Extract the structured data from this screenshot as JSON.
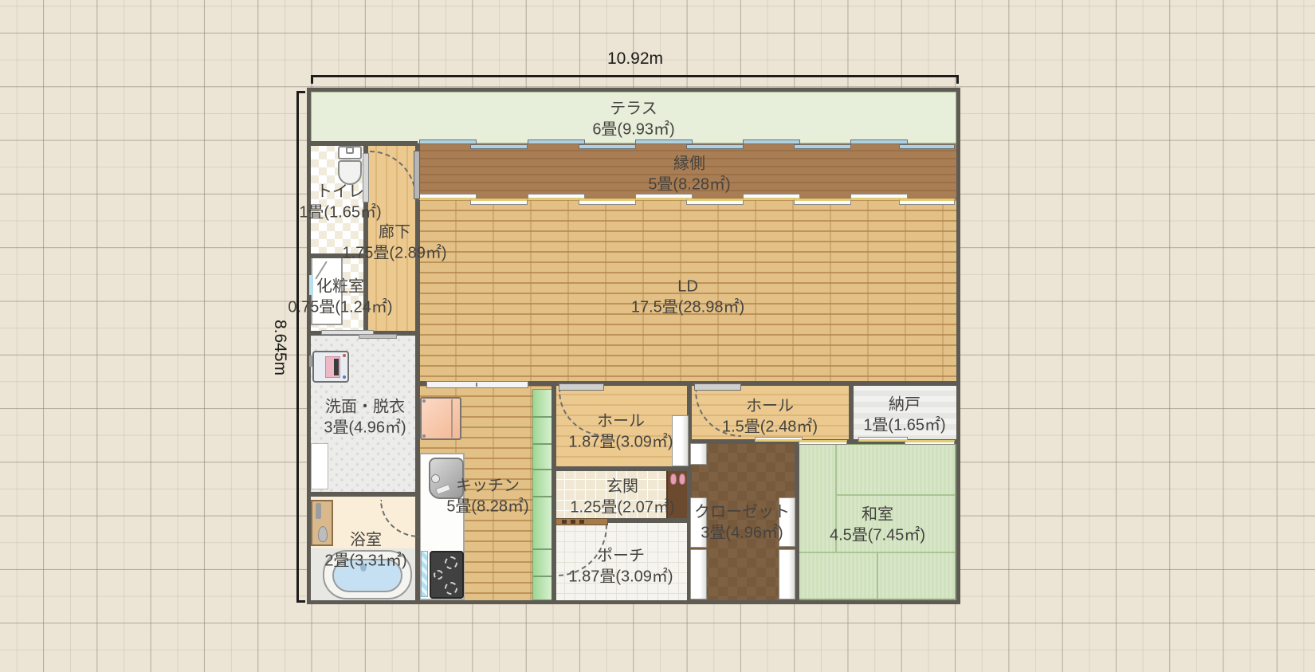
{
  "plan_title": "floor-plan",
  "dimensions": {
    "width_label": "10.92m",
    "height_label": "8.645m"
  },
  "rooms": [
    {
      "id": "terrace",
      "name": "テラス",
      "area": "6畳(9.93㎡)"
    },
    {
      "id": "engawa",
      "name": "縁側",
      "area": "5畳(8.28㎡)"
    },
    {
      "id": "ld",
      "name": "LD",
      "area": "17.5畳(28.98㎡)"
    },
    {
      "id": "toilet",
      "name": "トイレ",
      "area": "1畳(1.65㎡)"
    },
    {
      "id": "corridor",
      "name": "廊下",
      "area": "1.75畳(2.89㎡)"
    },
    {
      "id": "powder",
      "name": "化粧室",
      "area": "0.75畳(1.24㎡)"
    },
    {
      "id": "washroom",
      "name": "洗面・脱衣",
      "area": "3畳(4.96㎡)"
    },
    {
      "id": "bathroom",
      "name": "浴室",
      "area": "2畳(3.31㎡)"
    },
    {
      "id": "kitchen",
      "name": "キッチン",
      "area": "5畳(8.28㎡)"
    },
    {
      "id": "hall1",
      "name": "ホール",
      "area": "1.87畳(3.09㎡)"
    },
    {
      "id": "genkan",
      "name": "玄関",
      "area": "1.25畳(2.07㎡)"
    },
    {
      "id": "porch",
      "name": "ポーチ",
      "area": "1.87畳(3.09㎡)"
    },
    {
      "id": "hall2",
      "name": "ホール",
      "area": "1.5畳(2.48㎡)"
    },
    {
      "id": "nando",
      "name": "納戸",
      "area": "1畳(1.65㎡)"
    },
    {
      "id": "closet",
      "name": "クローゼット",
      "area": "3畳(4.96㎡)"
    },
    {
      "id": "washitsu",
      "name": "和室",
      "area": "4.5畳(7.45㎡)"
    }
  ],
  "fixtures": [
    "toilet-icon",
    "washbasin-icon",
    "washing-machine-icon",
    "shower-icon",
    "bathtub-icon",
    "refrigerator-icon",
    "kitchen-sink-icon",
    "stove-icon",
    "kitchen-towel-icon",
    "shelf-cabinet-icon",
    "entrance-mat-icon",
    "slippers-icon",
    "sliding-door-panel",
    "swing-door-arc",
    "window-sliding"
  ],
  "colors": {
    "background": "#ece4d4",
    "grid_major": "#8c877d",
    "wall": "#5d5b54",
    "terrace_green": "#e7eeda",
    "engawa_wood": "#aa7e54",
    "ld_brick": "#e3c086",
    "hall_wood": "#ecca8f",
    "tatami_green": "#cfe1bd",
    "closet_brown": "#7e6042",
    "window_glass_blue": "#aed2e2",
    "sliding_track_yellow": "#e2cc75",
    "cabinet_green": "#b7e4ac",
    "bath_water_blue": "#c5e0f2",
    "fridge_pink": "#f8cdb4",
    "slipper_pink": "#e2a0b4",
    "text": "#45433f",
    "dimension_text": "#1d1c1a"
  }
}
